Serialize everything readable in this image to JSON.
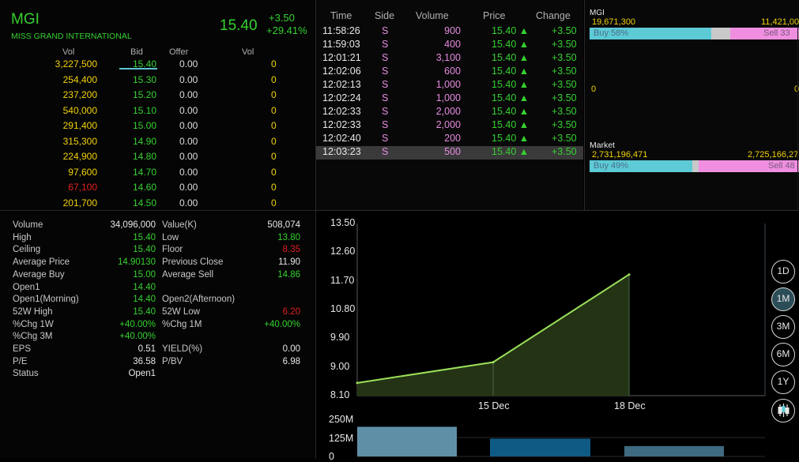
{
  "quote": {
    "symbol": "MGI",
    "company": "MISS GRAND INTERNATIONAL",
    "last": "15.40",
    "change": "+3.50",
    "change_pct": "+29.41%"
  },
  "book": {
    "headers": {
      "vol": "Vol",
      "bid": "Bid",
      "offer": "Offer",
      "offer_vol": "Vol"
    },
    "rows": [
      {
        "vol": "3,227,500",
        "bid": "15.40",
        "offer": "0.00",
        "ovol": "0",
        "vol_color": "#f2d20b",
        "bid_color": "#35d12f"
      },
      {
        "vol": "254,400",
        "bid": "15.30",
        "offer": "0.00",
        "ovol": "0",
        "vol_color": "#f2d20b",
        "bid_color": "#35d12f"
      },
      {
        "vol": "237,200",
        "bid": "15.20",
        "offer": "0.00",
        "ovol": "0",
        "vol_color": "#f2d20b",
        "bid_color": "#35d12f"
      },
      {
        "vol": "540,000",
        "bid": "15.10",
        "offer": "0.00",
        "ovol": "0",
        "vol_color": "#f2d20b",
        "bid_color": "#35d12f"
      },
      {
        "vol": "291,400",
        "bid": "15.00",
        "offer": "0.00",
        "ovol": "0",
        "vol_color": "#f2d20b",
        "bid_color": "#35d12f"
      },
      {
        "vol": "315,300",
        "bid": "14.90",
        "offer": "0.00",
        "ovol": "0",
        "vol_color": "#f2d20b",
        "bid_color": "#35d12f"
      },
      {
        "vol": "224,900",
        "bid": "14.80",
        "offer": "0.00",
        "ovol": "0",
        "vol_color": "#f2d20b",
        "bid_color": "#35d12f"
      },
      {
        "vol": "97,600",
        "bid": "14.70",
        "offer": "0.00",
        "ovol": "0",
        "vol_color": "#f2d20b",
        "bid_color": "#35d12f"
      },
      {
        "vol": "67,100",
        "bid": "14.60",
        "offer": "0.00",
        "ovol": "0",
        "vol_color": "#e02020",
        "bid_color": "#35d12f"
      },
      {
        "vol": "201,700",
        "bid": "14.50",
        "offer": "0.00",
        "ovol": "0",
        "vol_color": "#f2d20b",
        "bid_color": "#35d12f"
      }
    ]
  },
  "ticks": {
    "headers": {
      "time": "Time",
      "side": "Side",
      "volume": "Volume",
      "price": "Price",
      "change": "Change"
    },
    "rows": [
      {
        "time": "11:58:26",
        "side": "S",
        "volume": "900",
        "price": "15.40",
        "change": "+3.50"
      },
      {
        "time": "11:59:03",
        "side": "S",
        "volume": "400",
        "price": "15.40",
        "change": "+3.50"
      },
      {
        "time": "12:01:21",
        "side": "S",
        "volume": "3,100",
        "price": "15.40",
        "change": "+3.50"
      },
      {
        "time": "12:02:06",
        "side": "S",
        "volume": "600",
        "price": "15.40",
        "change": "+3.50"
      },
      {
        "time": "12:02:13",
        "side": "S",
        "volume": "1,000",
        "price": "15.40",
        "change": "+3.50"
      },
      {
        "time": "12:02:24",
        "side": "S",
        "volume": "1,000",
        "price": "15.40",
        "change": "+3.50"
      },
      {
        "time": "12:02:33",
        "side": "S",
        "volume": "2,000",
        "price": "15.40",
        "change": "+3.50"
      },
      {
        "time": "12:02:33",
        "side": "S",
        "volume": "2,000",
        "price": "15.40",
        "change": "+3.50"
      },
      {
        "time": "12:02:40",
        "side": "S",
        "volume": "200",
        "price": "15.40",
        "change": "+3.50"
      },
      {
        "time": "12:03:23",
        "side": "S",
        "volume": "500",
        "price": "15.40",
        "change": "+3.50"
      }
    ],
    "up_arrow": "▲"
  },
  "flow": {
    "stock": {
      "title": "MGI",
      "buy_value": "19,671,300",
      "sell_value": "11,421,00",
      "buy_label": "Buy 58%",
      "sell_label": "Sell 33",
      "buy_pct": 58,
      "sell_pct": 33
    },
    "middle_left": "0",
    "middle_right": "0",
    "market": {
      "title": "Market",
      "buy_value": "2,731,196,471",
      "sell_value": "2,725,166,27",
      "buy_label": "Buy 49%",
      "sell_label": "Sell 48",
      "buy_pct": 49,
      "sell_pct": 48
    }
  },
  "stats": {
    "left": [
      {
        "label": "Volume",
        "value": "34,096,000",
        "color": "#e8e8e8"
      },
      {
        "label": "High",
        "value": "15.40",
        "color": "#35d12f"
      },
      {
        "label": "Ceiling",
        "value": "15.40",
        "color": "#35d12f"
      },
      {
        "label": "Average Price",
        "value": "14.90130",
        "color": "#35d12f"
      },
      {
        "label": "Average Buy",
        "value": "15.00",
        "color": "#35d12f"
      },
      {
        "label": "Open1",
        "value": "14.40",
        "color": "#35d12f"
      },
      {
        "label": "Open1(Morning)",
        "value": "14.40",
        "color": "#35d12f"
      },
      {
        "label": "52W High",
        "value": "15.40",
        "color": "#35d12f"
      },
      {
        "label": "%Chg 1W",
        "value": "+40.00%",
        "color": "#35d12f"
      },
      {
        "label": "%Chg 3M",
        "value": "+40.00%",
        "color": "#35d12f"
      },
      {
        "label": "EPS",
        "value": "0.51",
        "color": "#e8e8e8"
      },
      {
        "label": "P/E",
        "value": "36.58",
        "color": "#e8e8e8"
      },
      {
        "label": "Status",
        "value": "Open1",
        "color": "#e8e8e8"
      }
    ],
    "right": [
      {
        "label": "Value(K)",
        "value": "508,074",
        "color": "#e8e8e8"
      },
      {
        "label": "Low",
        "value": "13.80",
        "color": "#35d12f"
      },
      {
        "label": "Floor",
        "value": "8.35",
        "color": "#e02020"
      },
      {
        "label": "Previous Close",
        "value": "11.90",
        "color": "#e8e8e8"
      },
      {
        "label": "Average Sell",
        "value": "14.86",
        "color": "#35d12f"
      },
      {
        "label": "",
        "value": "",
        "color": "#e8e8e8"
      },
      {
        "label": "Open2(Afternoon)",
        "value": "",
        "color": "#e8e8e8"
      },
      {
        "label": "52W Low",
        "value": "6.20",
        "color": "#e02020"
      },
      {
        "label": "%Chg 1M",
        "value": "+40.00%",
        "color": "#35d12f"
      },
      {
        "label": "",
        "value": "",
        "color": "#e8e8e8"
      },
      {
        "label": "YIELD(%)",
        "value": "0.00",
        "color": "#e8e8e8"
      },
      {
        "label": "P/BV",
        "value": "6.98",
        "color": "#e8e8e8"
      },
      {
        "label": "",
        "value": "",
        "color": "#e8e8e8"
      }
    ]
  },
  "period_buttons": [
    {
      "label": "1D",
      "active": false
    },
    {
      "label": "1M",
      "active": true
    },
    {
      "label": "3M",
      "active": false
    },
    {
      "label": "6M",
      "active": false
    },
    {
      "label": "1Y",
      "active": false
    }
  ],
  "chart_data": {
    "type": "area",
    "y_ticks": [
      "13.50",
      "12.60",
      "11.70",
      "10.80",
      "9.90",
      "9.00",
      "8.10"
    ],
    "ylim": [
      8.1,
      13.5
    ],
    "x_labels": [
      "15 Dec",
      "18 Dec"
    ],
    "x": [
      "start",
      "15 Dec",
      "18 Dec"
    ],
    "values": [
      8.5,
      9.15,
      11.9
    ],
    "line_color": "#9be05a",
    "fill_color": "#233314",
    "volume": {
      "y_ticks": [
        "250M",
        "125M",
        "0"
      ],
      "ylim": [
        0,
        250000000
      ],
      "bars": [
        {
          "value": 200000000,
          "color": "#5f8fa6"
        },
        {
          "value": 120000000,
          "color": "#0e5a85"
        },
        {
          "value": 70000000,
          "color": "#3f6a80"
        }
      ]
    }
  }
}
